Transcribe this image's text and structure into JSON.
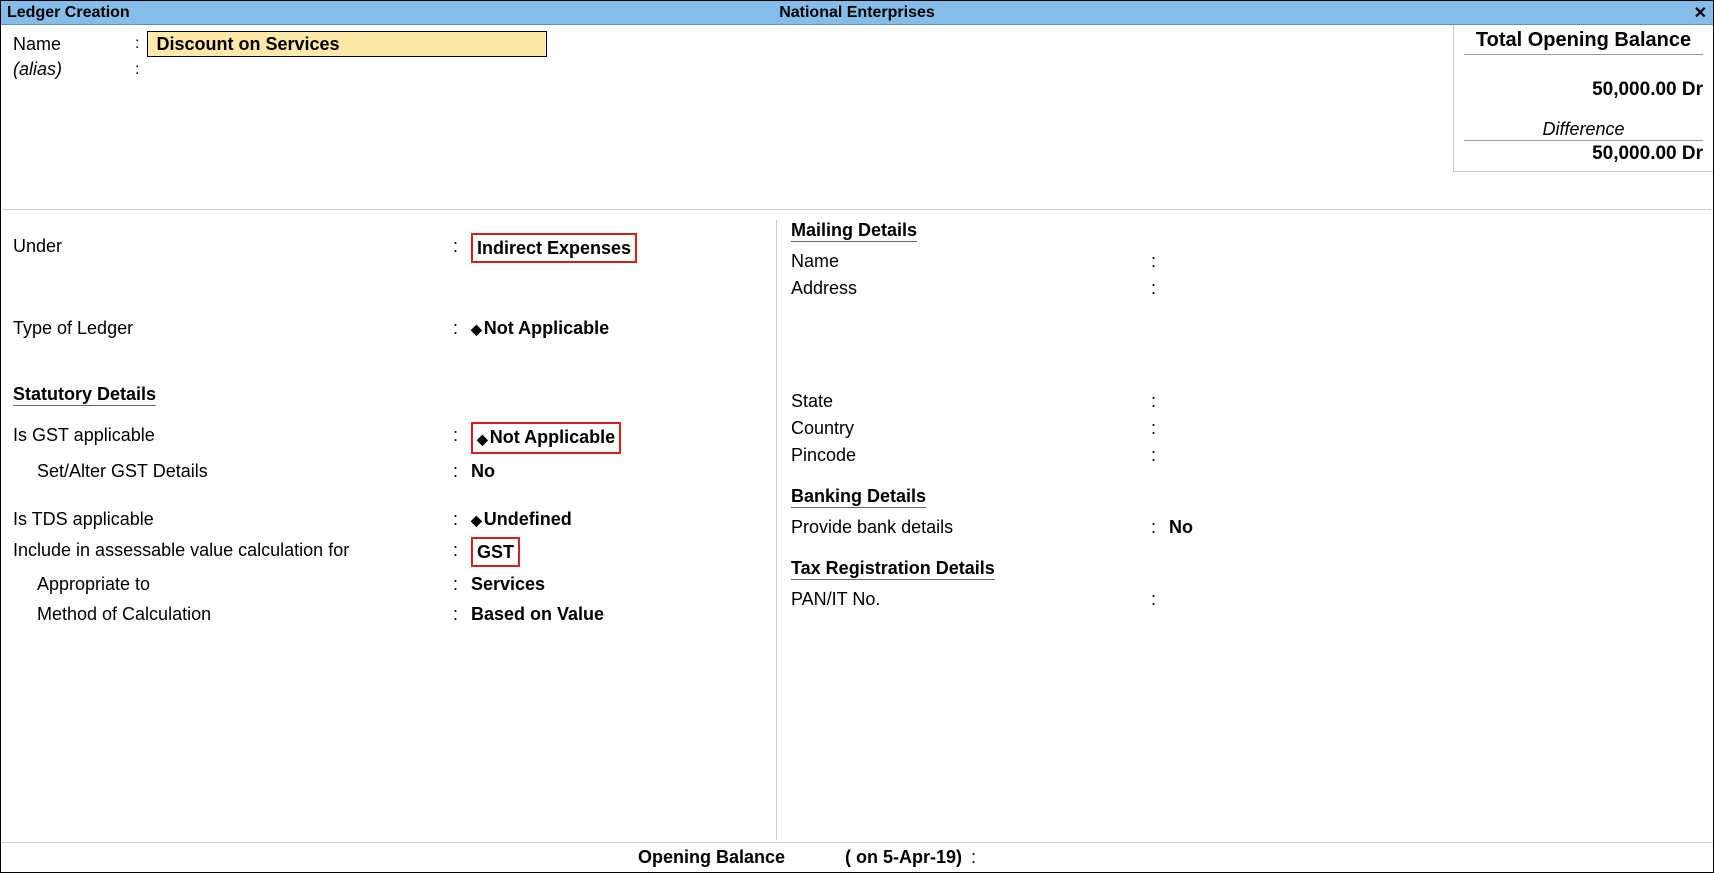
{
  "header": {
    "screen_title": "Ledger Creation",
    "company_name": "National Enterprises"
  },
  "name_section": {
    "name_label": "Name",
    "name_value": "Discount on Services",
    "alias_label": "(alias)"
  },
  "balance_box": {
    "title": "Total Opening Balance",
    "amount": "50,000.00 Dr",
    "difference_label": "Difference",
    "difference_amount": "50,000.00 Dr"
  },
  "left": {
    "under_label": "Under",
    "under_value": "Indirect Expenses",
    "type_of_ledger_label": "Type of Ledger",
    "type_of_ledger_value": "Not Applicable",
    "statutory_header": "Statutory Details",
    "gst_applicable_label": "Is GST applicable",
    "gst_applicable_value": "Not Applicable",
    "set_alter_gst_label": "Set/Alter GST Details",
    "set_alter_gst_value": "No",
    "tds_applicable_label": "Is TDS applicable",
    "tds_applicable_value": "Undefined",
    "include_assessable_label": "Include in assessable value calculation for",
    "include_assessable_value": "GST",
    "appropriate_to_label": "Appropriate to",
    "appropriate_to_value": "Services",
    "method_calc_label": "Method of Calculation",
    "method_calc_value": "Based on Value"
  },
  "right": {
    "mailing_header": "Mailing Details",
    "mail_name_label": "Name",
    "mail_address_label": "Address",
    "mail_state_label": "State",
    "mail_country_label": "Country",
    "mail_pincode_label": "Pincode",
    "banking_header": "Banking Details",
    "provide_bank_label": "Provide bank details",
    "provide_bank_value": "No",
    "tax_reg_header": "Tax Registration Details",
    "pan_it_label": "PAN/IT No."
  },
  "footer": {
    "opening_balance_label": "Opening Balance",
    "date_text": "( on 5-Apr-19)"
  }
}
